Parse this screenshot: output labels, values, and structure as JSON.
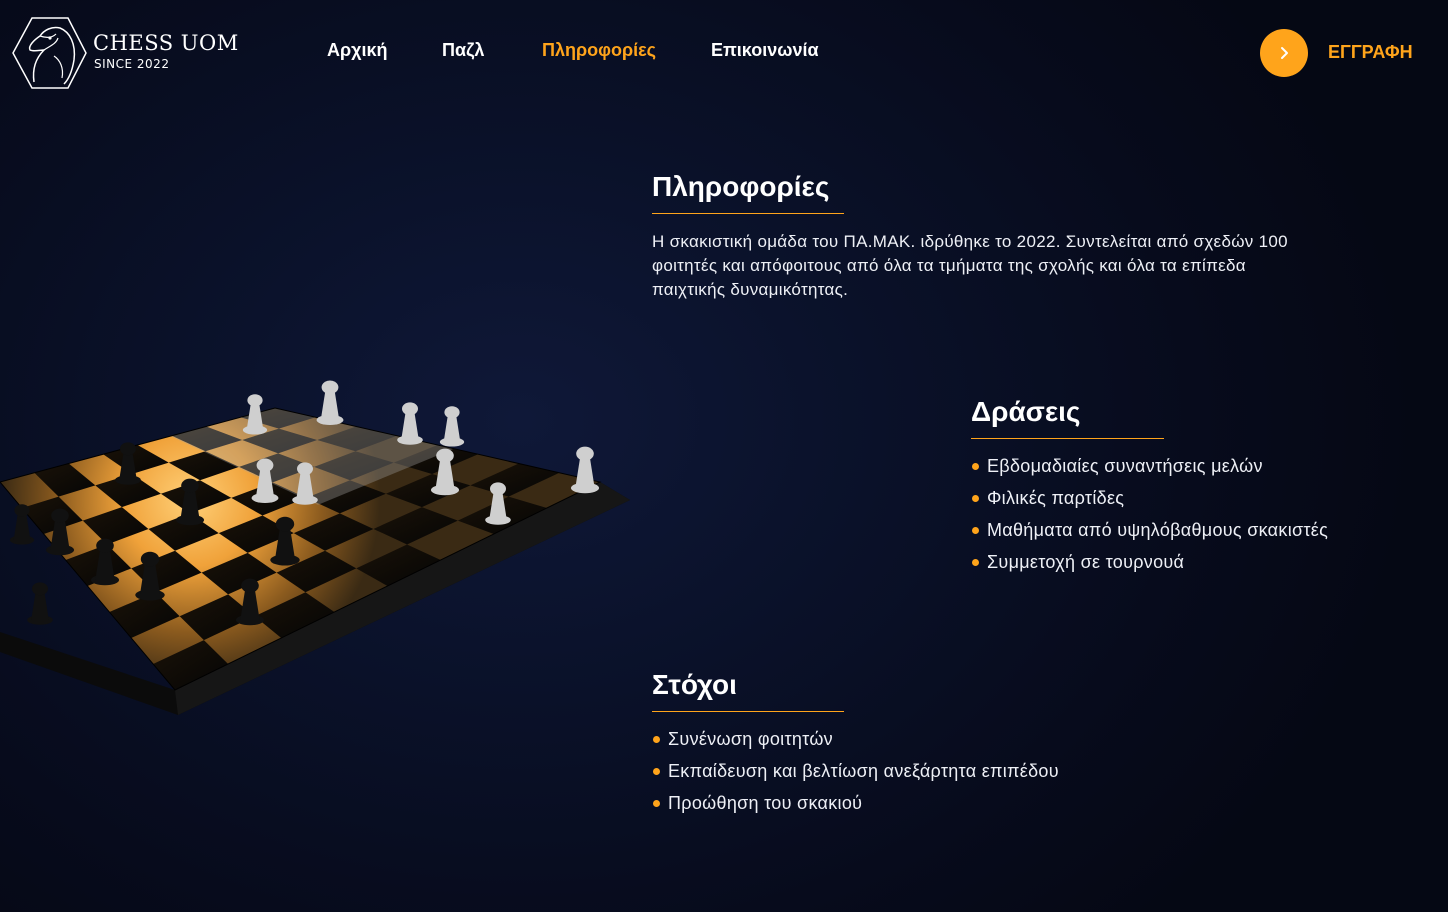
{
  "brand": {
    "title": "CHESS UOM",
    "subtitle": "SINCE 2022",
    "logo_icon": "knight-hexagon-icon"
  },
  "nav": {
    "items": [
      {
        "label": "Αρχική",
        "active": false
      },
      {
        "label": "Παζλ",
        "active": false
      },
      {
        "label": "Πληροφορίες",
        "active": true
      },
      {
        "label": "Επικοινωνία",
        "active": false
      }
    ]
  },
  "register": {
    "label": "ΕΓΓΡΑΦΗ",
    "icon": "chevron-right-icon"
  },
  "info": {
    "title": "Πληροφορίες",
    "text": "Η σκακιστική ομάδα του ΠΑ.ΜΑΚ. ιδρύθηκε το 2022. Συντελείται από σχεδών 100 φοιτητές και απόφοιτους από όλα τα τμήματα της σχολής και όλα τα επίπεδα παιχτικής δυναμικότητας."
  },
  "activities": {
    "title": "Δράσεις",
    "items": [
      "Εβδομαδιαίες συναντήσεις μελών",
      "Φιλικές παρτίδες",
      "Μαθήματα από υψηλόβαθμους σκακιστές",
      "Συμμετοχή σε τουρνουά"
    ]
  },
  "goals": {
    "title": "Στόχοι",
    "items": [
      "Συνένωση φοιτητών",
      "Εκπαίδευση και βελτίωση ανεξάρτητα επιπέδου",
      "Προώθηση του σκακιού"
    ]
  },
  "colors": {
    "accent": "#ffa41b",
    "background": "#070b1c",
    "text": "#ffffff"
  }
}
